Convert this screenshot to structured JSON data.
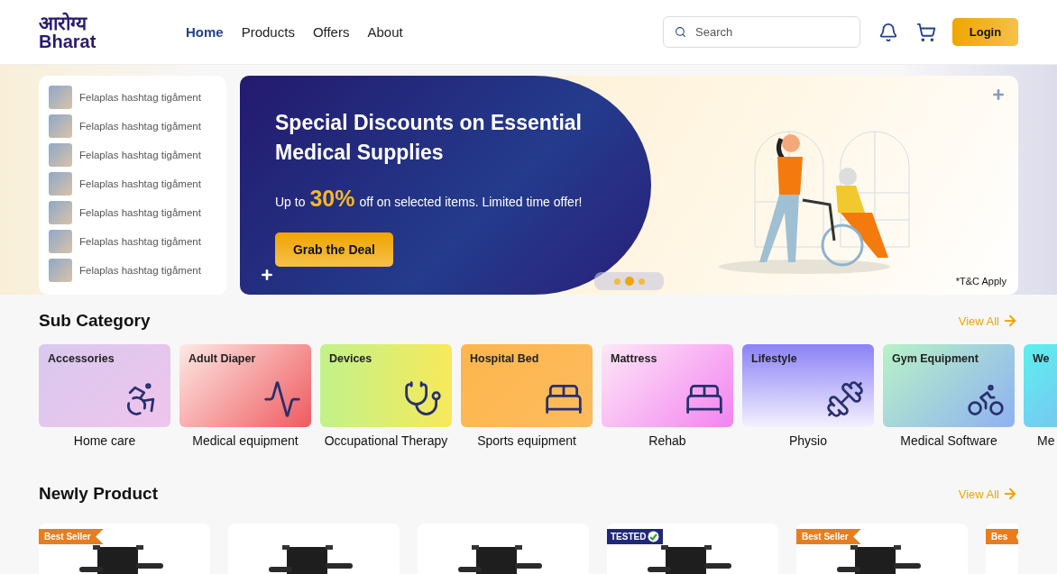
{
  "header": {
    "logo": {
      "line1": "आरोग्य",
      "line2": "Bharat"
    },
    "nav": [
      {
        "label": "Home",
        "selected": true
      },
      {
        "label": "Products",
        "selected": false
      },
      {
        "label": "Offers",
        "selected": false
      },
      {
        "label": "About",
        "selected": false
      }
    ],
    "search": {
      "placeholder": "Search"
    },
    "login": "Login"
  },
  "side_list": [
    "Felaplas hashtag tigåment",
    "Felaplas hashtag tigåment",
    "Felaplas hashtag tigåment",
    "Felaplas hashtag tigåment",
    "Felaplas hashtag tigåment",
    "Felaplas hashtag tigåment",
    "Felaplas hashtag tigåment"
  ],
  "banner": {
    "title": "Special Discounts on Essential Medical Supplies",
    "offer_before": "Up to",
    "offer_highlight": "30%",
    "offer_after": "off on selected items. Limited time offer!",
    "button": "Grab the Deal",
    "note": "*T&C Apply",
    "dots": [
      {
        "selected": false
      },
      {
        "selected": true
      },
      {
        "selected": false
      }
    ]
  },
  "sub_category": {
    "title": "Sub Category",
    "view_all": "View All",
    "items": [
      {
        "card_title": "Accessories",
        "label": "Home care"
      },
      {
        "card_title": "Adult Diaper",
        "label": "Medical equipment"
      },
      {
        "card_title": "Devices",
        "label": "Occupational Therapy"
      },
      {
        "card_title": "Hospital Bed",
        "label": "Sports equipment"
      },
      {
        "card_title": "Mattress",
        "label": "Rehab"
      },
      {
        "card_title": "Lifestyle",
        "label": "Physio"
      },
      {
        "card_title": "Gym Equipment",
        "label": "Medical Software"
      },
      {
        "card_title": "We",
        "label": "Me"
      }
    ]
  },
  "newly_product": {
    "title": "Newly Product",
    "view_all": "View All",
    "items": [
      {
        "kind": "best_seller",
        "badge": "Best Seller"
      },
      {
        "kind": "plain"
      },
      {
        "kind": "plain"
      },
      {
        "kind": "tested",
        "badge": "TESTED"
      },
      {
        "kind": "best_seller",
        "badge": "Best Seller"
      },
      {
        "kind": "best_seller",
        "badge": "Bes"
      }
    ]
  }
}
